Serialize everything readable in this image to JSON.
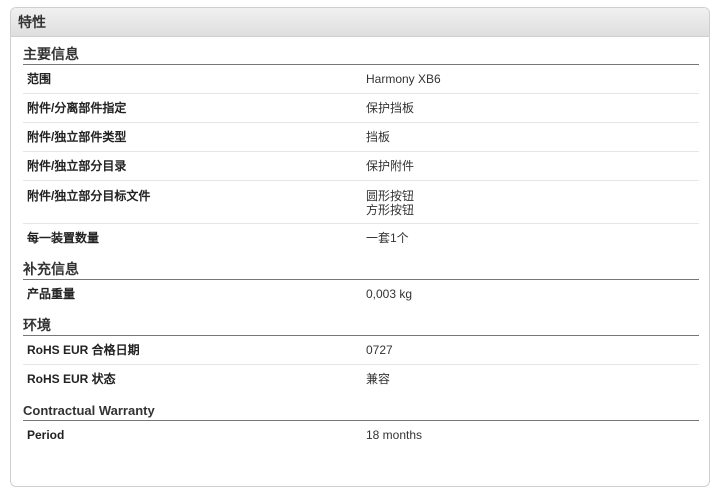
{
  "panel": {
    "title": "特性"
  },
  "sections": [
    {
      "title": "主要信息",
      "rows": [
        {
          "label": "范围",
          "value": "Harmony XB6"
        },
        {
          "label": "附件/分离部件指定",
          "value": "保护挡板"
        },
        {
          "label": "附件/独立部件类型",
          "value": "挡板"
        },
        {
          "label": "附件/独立部分目录",
          "value": "保护附件"
        },
        {
          "label": "附件/独立部分目标文件",
          "value_lines": [
            "圆形按钮",
            "方形按钮"
          ]
        },
        {
          "label": "每一装置数量",
          "value": "一套1个"
        }
      ]
    },
    {
      "title": "补充信息",
      "rows": [
        {
          "label": "产品重量",
          "value": "0,003 kg"
        }
      ]
    },
    {
      "title": "环境",
      "rows": [
        {
          "label": "RoHS EUR 合格日期",
          "value": "0727"
        },
        {
          "label": "RoHS EUR 状态",
          "value": "兼容"
        }
      ]
    },
    {
      "title": "Contractual Warranty",
      "rows": [
        {
          "label": "Period",
          "value": "18 months"
        }
      ]
    }
  ]
}
